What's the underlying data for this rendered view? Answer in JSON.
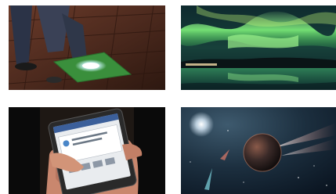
{
  "tiles": [
    {
      "subject": "glowing-floor-tile-with-walker",
      "dominant_color": "#3a8f3c"
    },
    {
      "subject": "aurora-over-lake",
      "dominant_color": "#5fd16a"
    },
    {
      "subject": "hand-holding-smartphone",
      "dominant_color": "#1a1a1a"
    },
    {
      "subject": "planet-with-comets-in-space",
      "dominant_color": "#1c2f3f"
    }
  ],
  "phone": {
    "screen_lines": [
      "",
      ""
    ]
  }
}
